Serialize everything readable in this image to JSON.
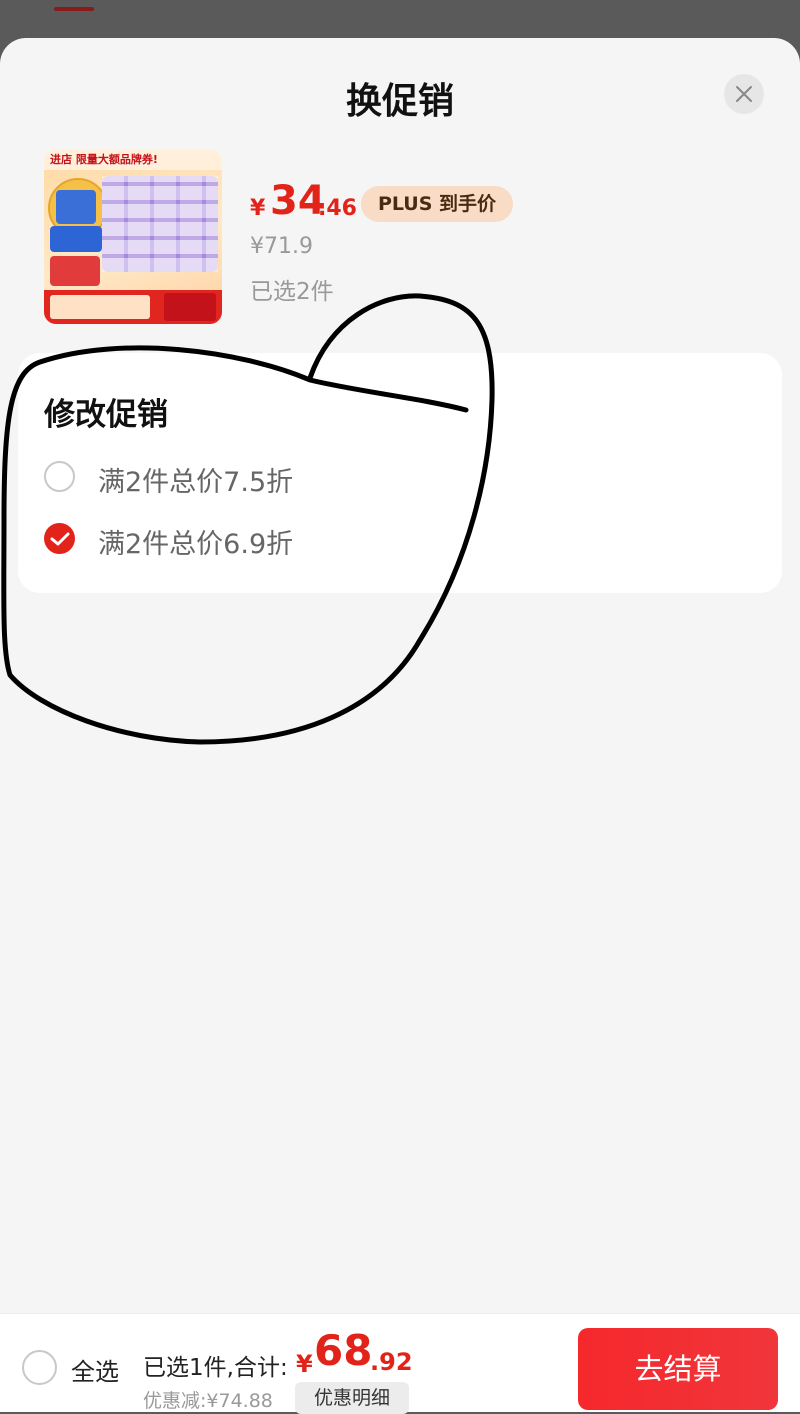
{
  "sheet": {
    "title": "换促销",
    "close_icon": "close-icon"
  },
  "product": {
    "image_icon": "product-image",
    "thumb_banner": "进店 限量大额品牌券!",
    "price": {
      "yen": "¥",
      "integer": "34",
      "decimal": ".46"
    },
    "price_tag": "PLUS 到手价",
    "original_price": "¥71.9",
    "selected": "已选2件"
  },
  "promotion": {
    "title": "修改促销",
    "options": [
      {
        "label": "满2件总价7.5折",
        "checked": false
      },
      {
        "label": "满2件总价6.9折",
        "checked": true
      }
    ]
  },
  "footer": {
    "select_all": "全选",
    "summary_prefix": "已选1件,合计:",
    "total": {
      "yen": "¥",
      "integer": "68",
      "decimal": ".92"
    },
    "discount": "优惠减:¥74.88",
    "detail_button": "优惠明细",
    "checkout_button": "去结算"
  },
  "colors": {
    "accent": "#e2231a",
    "plus_tag_bg": "#f8dcc6",
    "checkout_bg": "#f5282c"
  }
}
